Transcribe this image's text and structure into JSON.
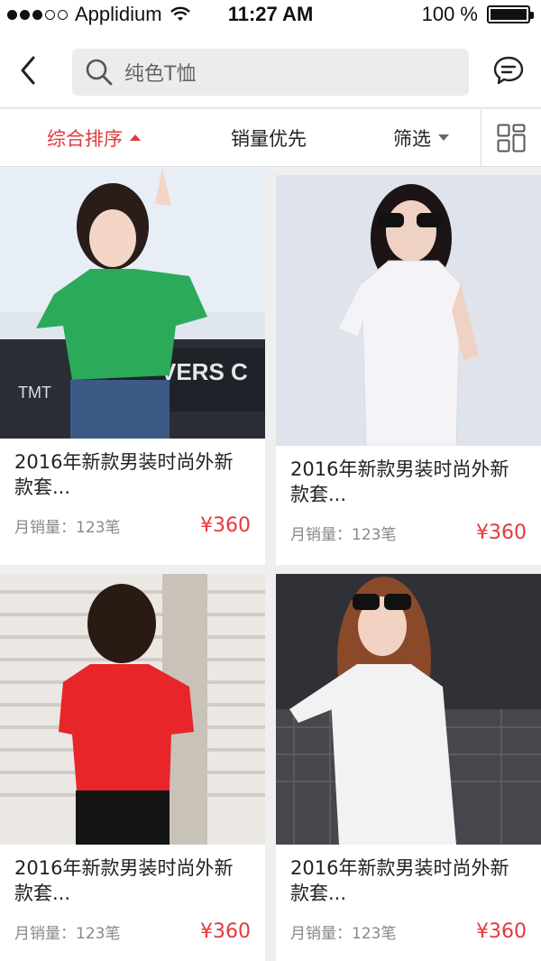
{
  "status_bar": {
    "carrier": "Applidium",
    "time": "11:27 AM",
    "battery": "100 %"
  },
  "header": {
    "search_placeholder": "纯色T恤",
    "back_icon": "back-arrow-icon",
    "message_icon": "chat-bubble-icon"
  },
  "filters": {
    "sort_label": "综合排序",
    "sales_label": "销量优先",
    "filter_label": "筛选",
    "view_icon": "grid-view-icon"
  },
  "products": [
    {
      "title": "2016年新款男装时尚外新款套...",
      "sales": "月销量：123笔",
      "price": "¥360",
      "shirt_color": "#2bab5a"
    },
    {
      "title": "2016年新款男装时尚外新款套...",
      "sales": "月销量：123笔",
      "price": "¥360",
      "shirt_color": "#f4f4f8"
    },
    {
      "title": "2016年新款男装时尚外新款套...",
      "sales": "月销量：123笔",
      "price": "¥360",
      "shirt_color": "#e8262a"
    },
    {
      "title": "2016年新款男装时尚外新款套...",
      "sales": "月销量：123笔",
      "price": "¥360",
      "shirt_color": "#f2f2f2"
    }
  ],
  "colors": {
    "accent": "#e4393c"
  }
}
